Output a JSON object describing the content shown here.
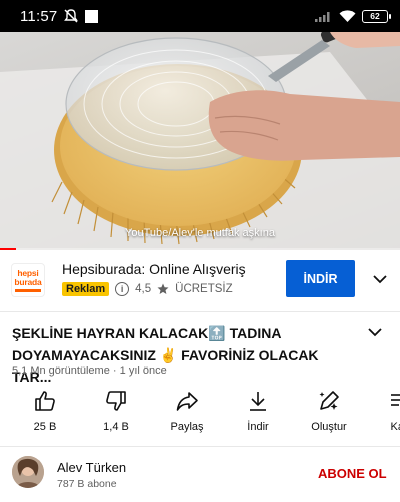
{
  "status_bar": {
    "time": "11:57",
    "battery": "62"
  },
  "video": {
    "caption": "YouTube/Alev'le mutfak aşkına",
    "progress": 0.04
  },
  "ad": {
    "logo_line1": "hepsi",
    "logo_line2": "burada",
    "title": "Hepsiburada: Online Alışveriş",
    "badge": "Reklam",
    "rating": "4,5",
    "price": "ÜCRETSİZ",
    "cta": "İNDİR",
    "brand_color": "#ff6000",
    "cta_color": "#065fd4"
  },
  "video_info": {
    "title": "ŞEKLİNE HAYRAN KALACAK🔝 TADINA DOYAMAYACAKSINIZ ✌️  FAVORİNİZ OLACAK TAR...",
    "views": "5,1 Mn görüntüleme",
    "age": "1 yıl önce",
    "separator": "·"
  },
  "actions": [
    {
      "label": "25 B",
      "icon": "thumbs-up-icon"
    },
    {
      "label": "1,4 B",
      "icon": "thumbs-down-icon"
    },
    {
      "label": "Paylaş",
      "icon": "share-icon"
    },
    {
      "label": "İndir",
      "icon": "download-icon"
    },
    {
      "label": "Oluştur",
      "icon": "create-icon"
    },
    {
      "label": "Kay",
      "icon": "save-icon"
    }
  ],
  "channel": {
    "name": "Alev Türken",
    "subscribers": "787 B abone",
    "subscribe_label": "ABONE OL",
    "subscribe_color": "#cc0000"
  }
}
